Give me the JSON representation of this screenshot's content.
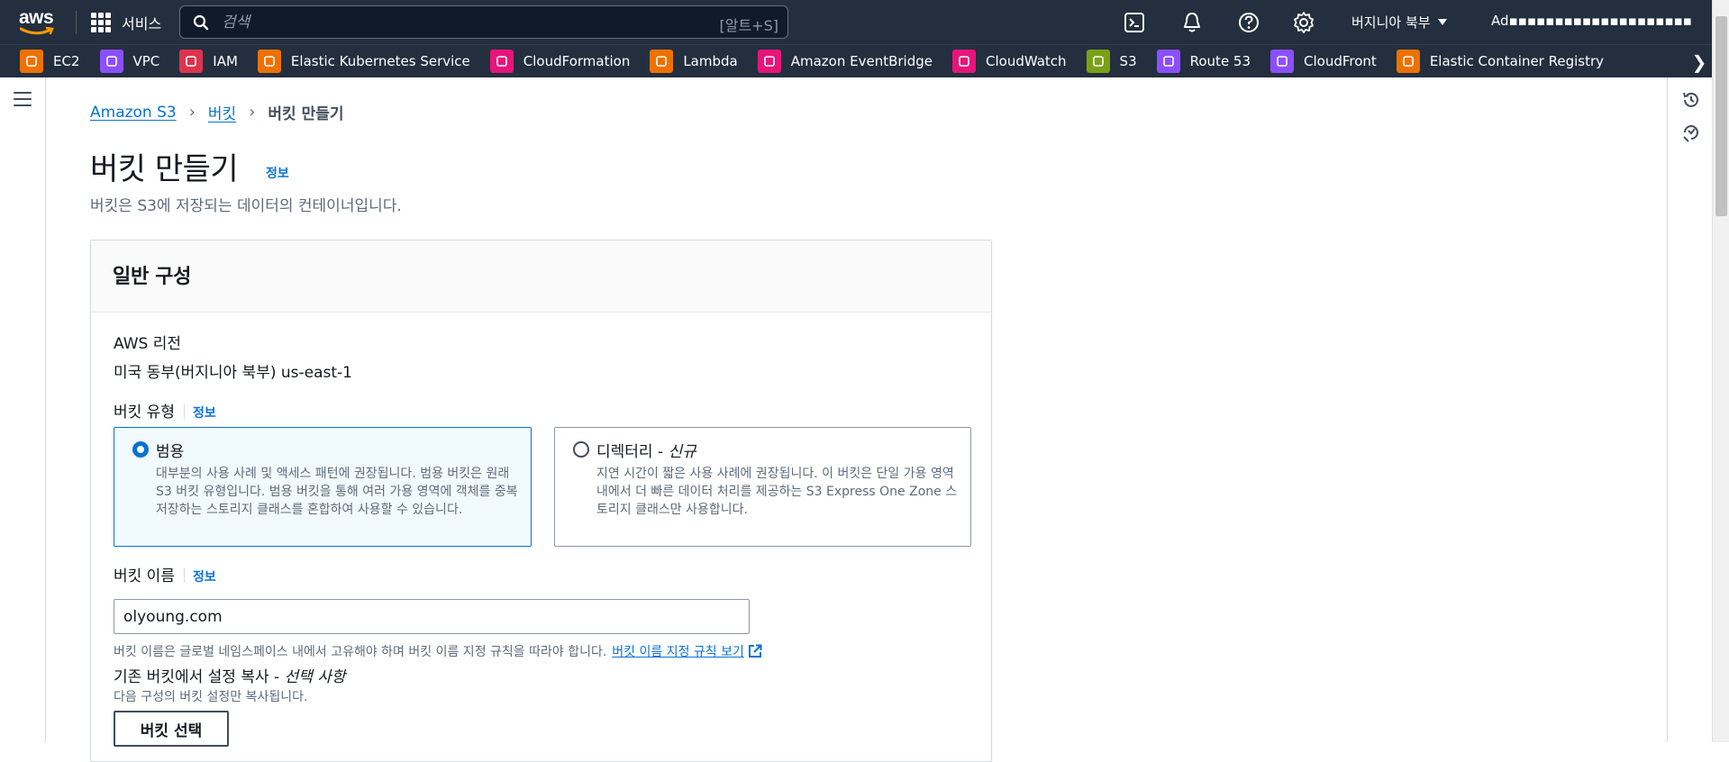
{
  "topnav": {
    "logo": "aws",
    "services_label": "서비스",
    "search_placeholder": "검색",
    "search_shortcut": "[알트+S]",
    "region": "버지니아 북부",
    "account": "Ad▪▪▪▪▪▪▪▪▪▪▪▪▪▪▪▪▪▪▪▪",
    "icons": [
      "cloudshell-icon",
      "bell-icon",
      "help-icon",
      "gear-icon"
    ]
  },
  "favorites": [
    {
      "label": "EC2",
      "color": "#ed7100"
    },
    {
      "label": "VPC",
      "color": "#8c4fff"
    },
    {
      "label": "IAM",
      "color": "#dd344c"
    },
    {
      "label": "Elastic Kubernetes Service",
      "color": "#ed7100"
    },
    {
      "label": "CloudFormation",
      "color": "#e7157b"
    },
    {
      "label": "Lambda",
      "color": "#ed7100"
    },
    {
      "label": "Amazon EventBridge",
      "color": "#e7157b"
    },
    {
      "label": "CloudWatch",
      "color": "#e7157b"
    },
    {
      "label": "S3",
      "color": "#7aa116"
    },
    {
      "label": "Route 53",
      "color": "#8c4fff"
    },
    {
      "label": "CloudFront",
      "color": "#8c4fff"
    },
    {
      "label": "Elastic Container Registry",
      "color": "#ed7100"
    }
  ],
  "breadcrumb": {
    "root": "Amazon S3",
    "parent": "버킷",
    "current": "버킷 만들기"
  },
  "page": {
    "title": "버킷 만들기",
    "info": "정보",
    "description": "버킷은 S3에 저장되는 데이터의 컨테이너입니다."
  },
  "general": {
    "heading": "일반 구성",
    "region_label": "AWS 리전",
    "region_value": "미국 동부(버지니아 북부) us-east-1",
    "bucket_type_label": "버킷 유형",
    "info": "정보",
    "type_general": {
      "title": "범용",
      "desc": "대부분의 사용 사례 및 액세스 패턴에 권장됩니다. 범용 버킷은 원래 S3 버킷 유형입니다. 범용 버킷을 통해 여러 가용 영역에 객체를 중복 저장하는 스토리지 클래스를 혼합하여 사용할 수 있습니다."
    },
    "type_directory": {
      "title": "디렉터리 - ",
      "title_new": "신규",
      "desc": "지연 시간이 짧은 사용 사례에 권장됩니다. 이 버킷은 단일 가용 영역 내에서 더 빠른 데이터 처리를 제공하는 S3 Express One Zone 스토리지 클래스만 사용합니다."
    },
    "bucket_name_label": "버킷 이름",
    "bucket_name_value": "olyoung.com",
    "bucket_name_hint": "버킷 이름은 글로벌 네임스페이스 내에서 고유해야 하며 버킷 이름 지정 규칙을 따라야 합니다.",
    "bucket_name_rules_link": "버킷 이름 지정 규칙 보기",
    "copy_label": "기존 버킷에서 설정 복사 - ",
    "copy_optional": "선택 사항",
    "copy_desc": "다음 구성의 버킷 설정만 복사됩니다.",
    "choose_bucket_button": "버킷 선택"
  }
}
